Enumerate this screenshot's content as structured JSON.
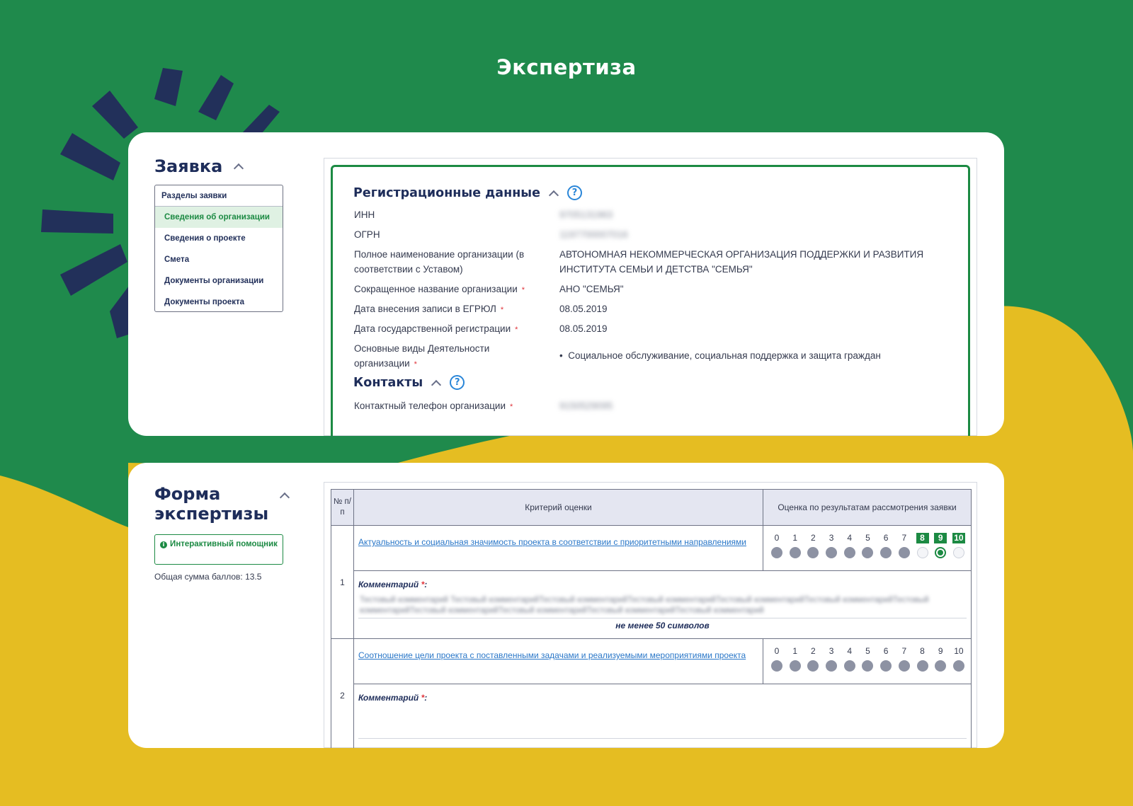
{
  "page": {
    "title": "Экспертиза"
  },
  "colors": {
    "background_green": "#1f8a4c",
    "background_yellow": "#e5bd22",
    "accent": "#1c8a43",
    "navy": "#22305a",
    "link": "#2a77c8"
  },
  "application_card": {
    "title": "Заявка",
    "sections_header": "Разделы заявки",
    "sections": [
      "Сведения об организации",
      "Сведения о проекте",
      "Смета",
      "Документы организации",
      "Документы проекта"
    ],
    "active_section": "Сведения об организации",
    "registration": {
      "title": "Регистрационные данные",
      "fields": [
        {
          "label": "ИНН",
          "value": "9705131963",
          "required": false,
          "blurred": true
        },
        {
          "label": "ОГРН",
          "value": "1197700007016",
          "required": false,
          "blurred": true
        },
        {
          "label": "Полное наименование организации (в соответствии с Уставом)",
          "value": "АВТОНОМНАЯ НЕКОММЕРЧЕСКАЯ ОРГАНИЗАЦИЯ ПОДДЕРЖКИ И РАЗВИТИЯ ИНСТИТУТА СЕМЬИ И ДЕТСТВА \"СЕМЬЯ\"",
          "required": false,
          "blurred": false
        },
        {
          "label": "Сокращенное название организации",
          "value": "АНО \"СЕМЬЯ\"",
          "required": true,
          "blurred": false
        },
        {
          "label": "Дата внесения записи в ЕГРЮЛ",
          "value": "08.05.2019",
          "required": true,
          "blurred": false
        },
        {
          "label": "Дата государственной регистрации",
          "value": "08.05.2019",
          "required": true,
          "blurred": false
        },
        {
          "label": "Основные виды Деятельности организации",
          "value": "Социальное обслуживание, социальная поддержка и защита граждан",
          "required": true,
          "blurred": false
        }
      ]
    },
    "contacts": {
      "title": "Контакты",
      "fields": [
        {
          "label": "Контактный телефон организации",
          "value": "9150529095",
          "required": true,
          "blurred": true
        }
      ]
    },
    "required_mark": "*",
    "help_mark": "?"
  },
  "expertise_card": {
    "title_line1": "Форма",
    "title_line2": "экспертизы",
    "helper_button": "Интерактивный помощник",
    "total_score": "Общая сумма баллов: 13.5",
    "table": {
      "col_num": "№ п/п",
      "col_criterion": "Критерий оценки",
      "col_score": "Оценка по результатам рассмотрения заявки",
      "scale": [
        "0",
        "1",
        "2",
        "3",
        "4",
        "5",
        "6",
        "7",
        "8",
        "9",
        "10"
      ],
      "comment_label": "Комментарий",
      "rows": [
        {
          "num": "1",
          "criterion": "Актуальность и социальная значимость проекта в соответствии с приоритетными направлениями",
          "selected": 9,
          "highlight": [
            8,
            9,
            10
          ],
          "comment": "Тестовый комментарий Тестовый комментарийТестовый комментарийТестовый комментарийТестовый комментарийТестовый комментарийТестовый комментарийТестовый комментарийТестовый комментарийТестовый комментарийТестовый комментарий",
          "min_note": "не менее 50 символов"
        },
        {
          "num": "2",
          "criterion": "Соотношение цели проекта с поставленными задачами и реализуемыми мероприятиями проекта",
          "selected": null,
          "highlight": [],
          "comment": "",
          "min_note": ""
        }
      ]
    }
  }
}
